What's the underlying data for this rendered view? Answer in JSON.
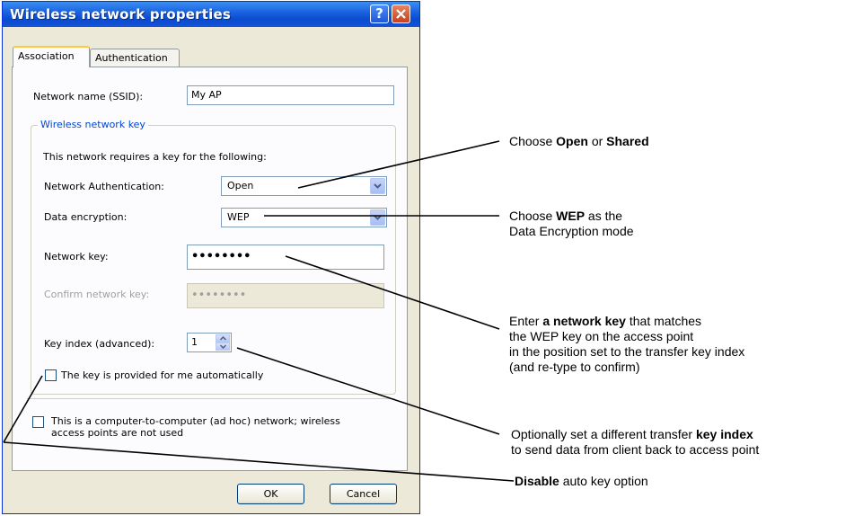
{
  "window": {
    "title": "Wireless network properties",
    "help_label": "?",
    "titlebar_color": "#0a4bd0"
  },
  "tabs": [
    {
      "label": "Association",
      "selected": true
    },
    {
      "label": "Authentication",
      "selected": false
    }
  ],
  "association": {
    "ssid_label": "Network name (SSID):",
    "ssid_value": "My AP",
    "group_title": "Wireless network key",
    "requires_text": "This network requires a key for the following:",
    "auth_label": "Network Authentication:",
    "auth_value": "Open",
    "enc_label": "Data encryption:",
    "enc_value": "WEP",
    "key_label": "Network key:",
    "key_value": "••••••••",
    "confirm_label": "Confirm network key:",
    "confirm_value": "••••••••",
    "key_index_label": "Key index (advanced):",
    "key_index_value": "1",
    "auto_key_label": "The key is provided for me automatically",
    "auto_key_checked": false,
    "adhoc_label_line1": "This is a computer-to-computer (ad hoc) network; wireless",
    "adhoc_label_line2": "access points are not used",
    "adhoc_checked": false
  },
  "buttons": {
    "ok": "OK",
    "cancel": "Cancel"
  },
  "annotations": {
    "open_shared": {
      "pre": "Choose ",
      "b1": "Open",
      "mid": " or ",
      "b2": "Shared"
    },
    "wep": {
      "pre": "Choose ",
      "b1": "WEP",
      "post": " as the",
      "line2": "Data Encryption mode"
    },
    "network_key": {
      "pre": "Enter ",
      "b1": "a network key",
      "post": " that matches",
      "line2": "the WEP key on the access point",
      "line3": "in the position set to the transfer key index",
      "line4": "(and re-type to confirm)"
    },
    "key_index": {
      "pre": "Optionally set a different transfer ",
      "b1": "key index",
      "line2": "to send data from client back to access point"
    },
    "disable_auto": {
      "b1": "Disable",
      "post": " auto key option"
    }
  }
}
